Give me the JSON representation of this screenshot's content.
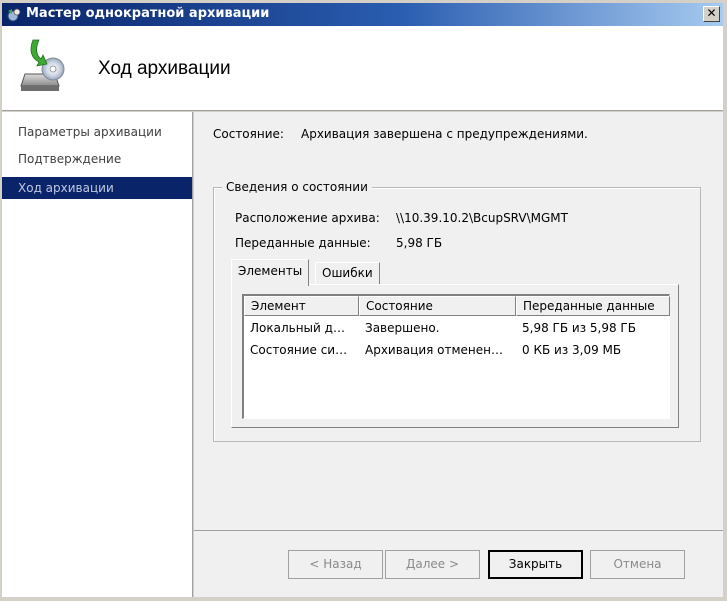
{
  "window": {
    "title": "Мастер однократной архивации",
    "close_glyph": "✕",
    "title_icon": "backup-wizard-icon"
  },
  "header": {
    "title": "Ход архивации",
    "icon": "disk-backup-icon"
  },
  "sidebar": {
    "items": [
      {
        "label": "Параметры архивации",
        "active": false
      },
      {
        "label": "Подтверждение",
        "active": false
      },
      {
        "label": "Ход архивации",
        "active": true
      }
    ]
  },
  "status": {
    "label": "Состояние:",
    "value": "Архивация завершена с предупреждениями."
  },
  "details": {
    "legend": "Сведения о состоянии",
    "location_label": "Расположение архива:",
    "location_value": "\\\\10.39.10.2\\BcupSRV\\MGMT",
    "transferred_label": "Переданные данные:",
    "transferred_value": "5,98 ГБ"
  },
  "tabs": [
    {
      "label": "Элементы",
      "active": true
    },
    {
      "label": "Ошибки",
      "active": false
    }
  ],
  "table": {
    "columns": [
      "Элемент",
      "Состояние",
      "Переданные данные"
    ],
    "rows": [
      [
        "Локальный д…",
        "Завершено.",
        "5,98 ГБ из 5,98 ГБ"
      ],
      [
        "Состояние си…",
        "Архивация отменен…",
        "0 КБ из 3,09 МБ"
      ]
    ]
  },
  "buttons": {
    "back": "< Назад",
    "next": "Далее >",
    "close": "Закрыть",
    "cancel": "Отмена"
  },
  "colors": {
    "title_bar": "#0a246a",
    "nav_selected": "#0a246a",
    "dialog_bg": "#f0f0f0"
  }
}
